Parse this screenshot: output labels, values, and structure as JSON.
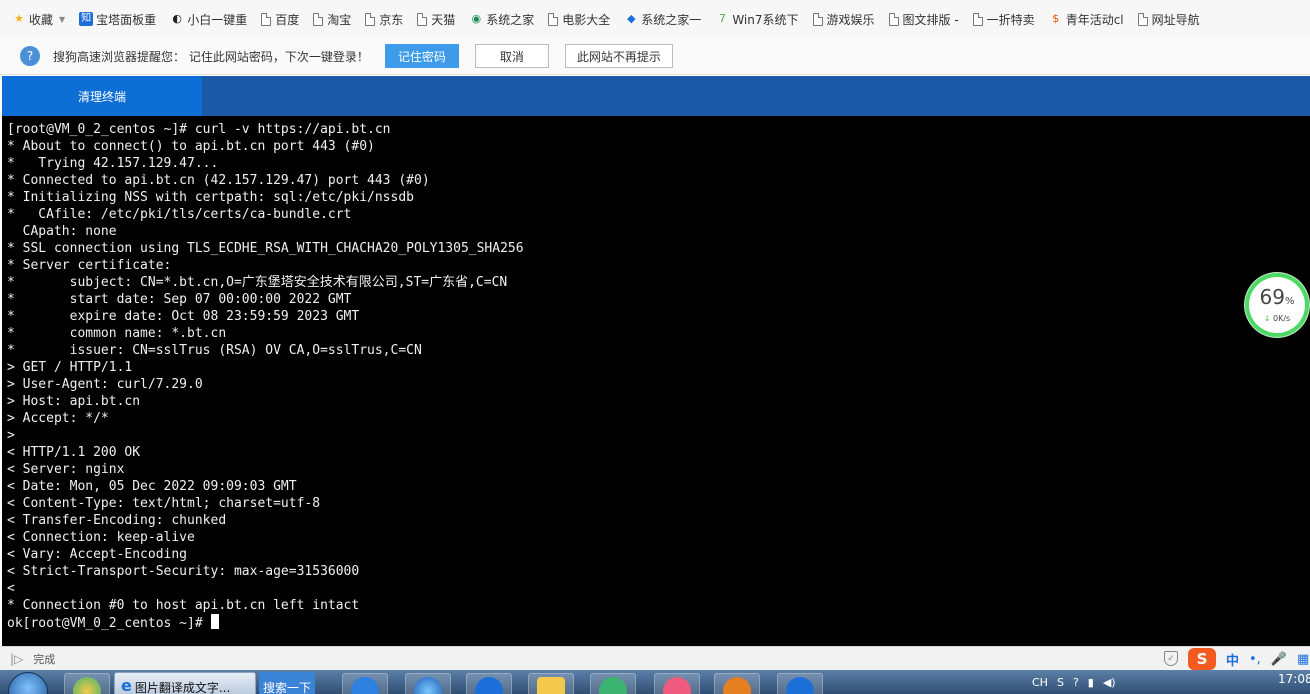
{
  "bookmarks": [
    {
      "label": "收藏",
      "icon": "star-icon"
    },
    {
      "label": "宝塔面板重",
      "icon": "bt-icon"
    },
    {
      "label": "小白一键重",
      "icon": "xiaobai-icon"
    },
    {
      "label": "百度",
      "icon": "page-icon"
    },
    {
      "label": "淘宝",
      "icon": "page-icon"
    },
    {
      "label": "京东",
      "icon": "page-icon"
    },
    {
      "label": "天猫",
      "icon": "page-icon"
    },
    {
      "label": "系统之家",
      "icon": "xitong-icon"
    },
    {
      "label": "电影大全",
      "icon": "page-icon"
    },
    {
      "label": "系统之家一",
      "icon": "xitong2-icon"
    },
    {
      "label": "Win7系统下",
      "icon": "win7-icon"
    },
    {
      "label": "游戏娱乐",
      "icon": "page-icon"
    },
    {
      "label": "图文排版 -",
      "icon": "page-icon"
    },
    {
      "label": "一折特卖",
      "icon": "page-icon"
    },
    {
      "label": "青年活动cl",
      "icon": "qingnian-icon"
    },
    {
      "label": "网址导航",
      "icon": "page-icon"
    }
  ],
  "password_prompt": {
    "message": "搜狗高速浏览器提醒您： 记住此网站密码，下次一键登录！",
    "remember_label": "记住密码",
    "cancel_label": "取消",
    "never_label": "此网站不再提示"
  },
  "app": {
    "clear_terminal_label": "清理终端"
  },
  "terminal": {
    "lines": [
      "[root@VM_0_2_centos ~]# curl -v https://api.bt.cn",
      "* About to connect() to api.bt.cn port 443 (#0)",
      "*   Trying 42.157.129.47...",
      "* Connected to api.bt.cn (42.157.129.47) port 443 (#0)",
      "* Initializing NSS with certpath: sql:/etc/pki/nssdb",
      "*   CAfile: /etc/pki/tls/certs/ca-bundle.crt",
      "  CApath: none",
      "* SSL connection using TLS_ECDHE_RSA_WITH_CHACHA20_POLY1305_SHA256",
      "* Server certificate:",
      "*       subject: CN=*.bt.cn,O=广东堡塔安全技术有限公司,ST=广东省,C=CN",
      "*       start date: Sep 07 00:00:00 2022 GMT",
      "*       expire date: Oct 08 23:59:59 2023 GMT",
      "*       common name: *.bt.cn",
      "*       issuer: CN=sslTrus (RSA) OV CA,O=sslTrus,C=CN",
      "> GET / HTTP/1.1",
      "> User-Agent: curl/7.29.0",
      "> Host: api.bt.cn",
      "> Accept: */*",
      ">",
      "< HTTP/1.1 200 OK",
      "< Server: nginx",
      "< Date: Mon, 05 Dec 2022 09:09:03 GMT",
      "< Content-Type: text/html; charset=utf-8",
      "< Transfer-Encoding: chunked",
      "< Connection: keep-alive",
      "< Vary: Accept-Encoding",
      "< Strict-Transport-Security: max-age=31536000",
      "<",
      "* Connection #0 to host api.bt.cn left intact"
    ],
    "prompt": "ok[root@VM_0_2_centos ~]# "
  },
  "net_widget": {
    "percent": "69",
    "percent_unit": "%",
    "speed": "0K/s"
  },
  "status_bar": {
    "text": "完成"
  },
  "ime": {
    "lang": "中"
  },
  "taskbar": {
    "browser_title": "图片翻译成文字...",
    "search_label": "搜索一下",
    "tray_lang": "CH",
    "clock": "17:08"
  }
}
